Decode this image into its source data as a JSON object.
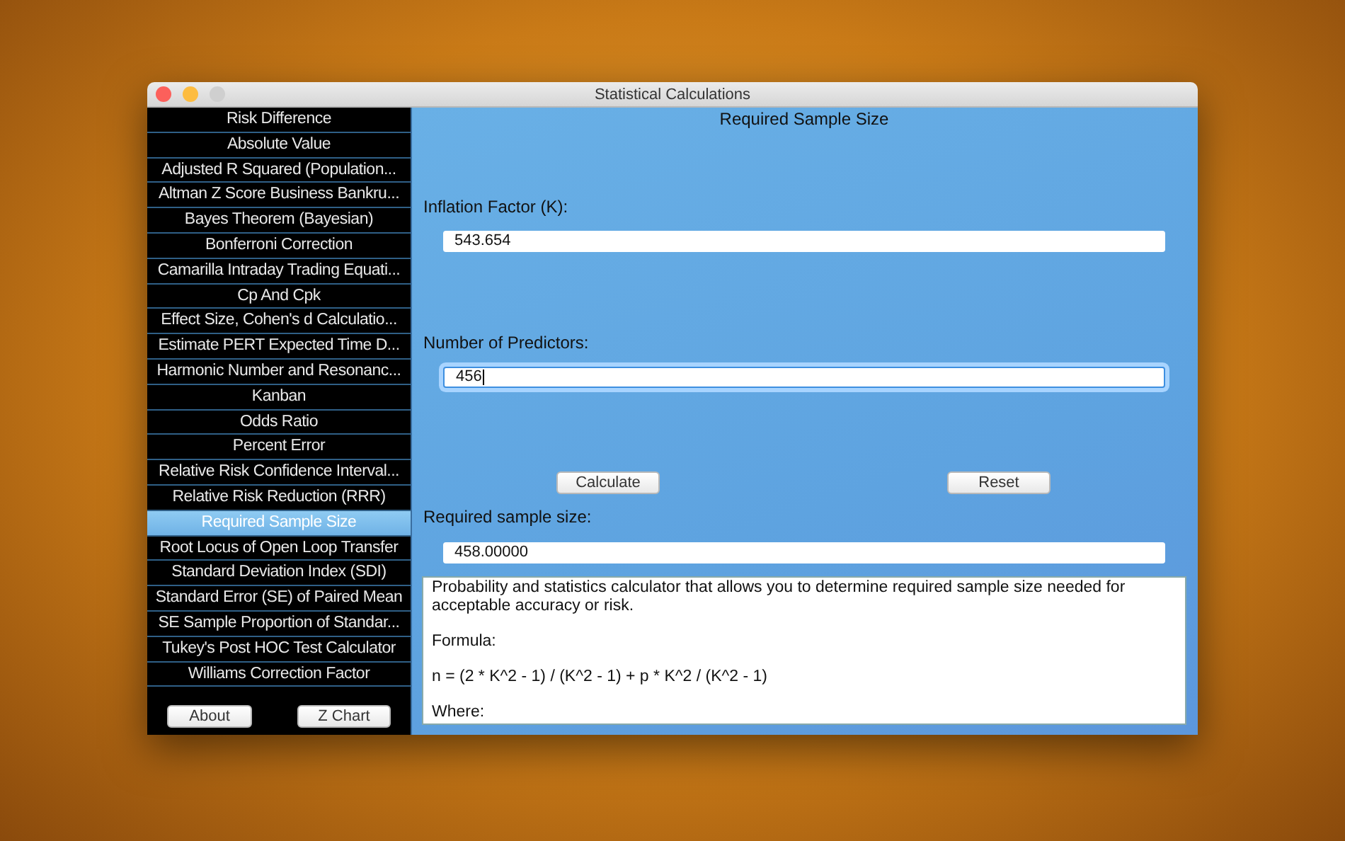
{
  "window": {
    "title": "Statistical Calculations"
  },
  "sidebar": {
    "items": [
      {
        "label": "Risk Difference",
        "selected": false
      },
      {
        "label": "Absolute Value",
        "selected": false
      },
      {
        "label": "Adjusted R Squared (Population...",
        "selected": false
      },
      {
        "label": "Altman Z Score Business Bankru...",
        "selected": false
      },
      {
        "label": "Bayes Theorem (Bayesian)",
        "selected": false
      },
      {
        "label": "Bonferroni Correction",
        "selected": false
      },
      {
        "label": "Camarilla Intraday Trading Equati...",
        "selected": false
      },
      {
        "label": "Cp And Cpk",
        "selected": false
      },
      {
        "label": "Effect Size, Cohen's d Calculatio...",
        "selected": false
      },
      {
        "label": "Estimate PERT Expected Time D...",
        "selected": false
      },
      {
        "label": "Harmonic Number and Resonanc...",
        "selected": false
      },
      {
        "label": "Kanban",
        "selected": false
      },
      {
        "label": "Odds Ratio",
        "selected": false
      },
      {
        "label": "Percent Error",
        "selected": false
      },
      {
        "label": "Relative Risk Confidence Interval...",
        "selected": false
      },
      {
        "label": "Relative Risk Reduction (RRR)",
        "selected": false
      },
      {
        "label": "Required Sample Size",
        "selected": true
      },
      {
        "label": "Root Locus of Open Loop Transfer",
        "selected": false
      },
      {
        "label": "Standard Deviation Index (SDI)",
        "selected": false
      },
      {
        "label": "Standard Error (SE) of Paired Mean",
        "selected": false
      },
      {
        "label": "SE Sample Proportion of Standar...",
        "selected": false
      },
      {
        "label": "Tukey's Post HOC Test Calculator",
        "selected": false
      },
      {
        "label": "Williams Correction Factor",
        "selected": false
      }
    ],
    "buttons": [
      "About",
      "Z Chart"
    ]
  },
  "main": {
    "title": "Required Sample Size",
    "inputs": [
      {
        "label": "Inflation Factor (K):",
        "value": "543.654",
        "focused": false
      },
      {
        "label": "Number of Predictors:",
        "value": "456",
        "focused": true
      }
    ],
    "buttons": [
      "Calculate",
      "Reset"
    ],
    "result": {
      "label": "Required sample size:",
      "value": "458.00000"
    },
    "description": [
      "Probability and statistics calculator that allows you to determine required sample size needed for acceptable accuracy or risk.",
      "Formula:",
      "n = (2 * K^2 - 1) / (K^2 - 1) + p * K^2 / (K^2 - 1)",
      "Where:"
    ]
  }
}
